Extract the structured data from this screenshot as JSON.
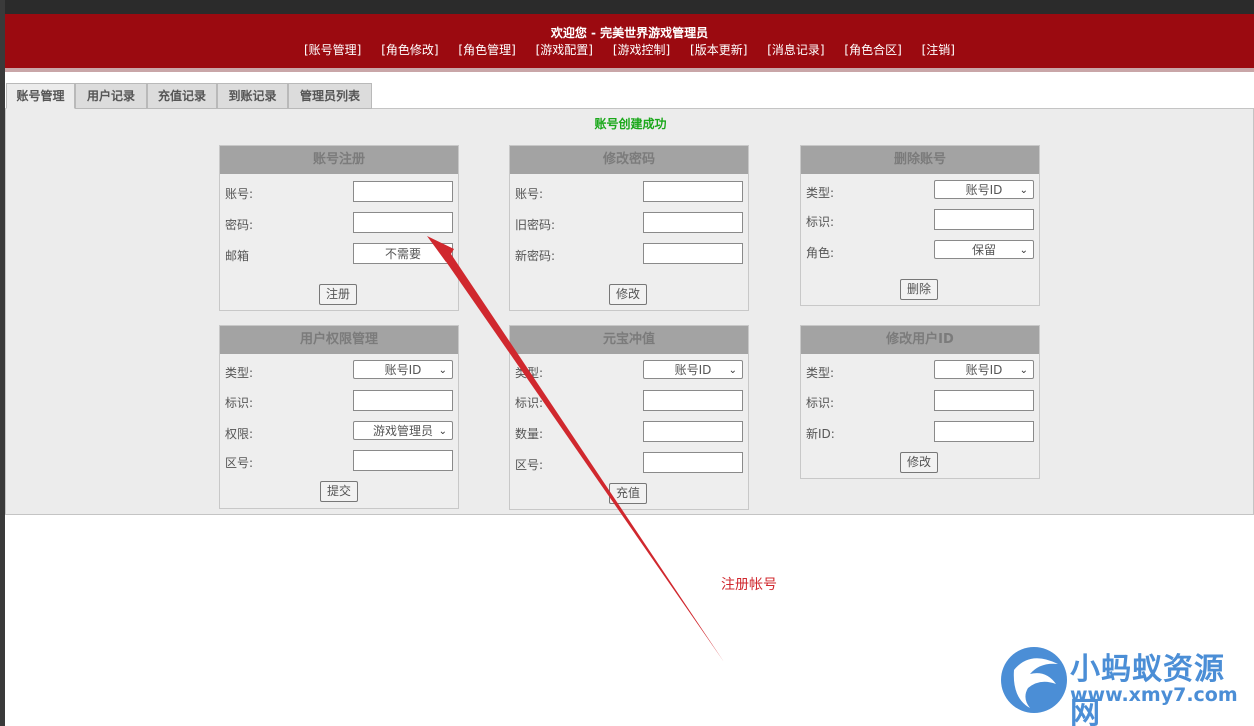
{
  "header": {
    "welcome": "欢迎您 - 完美世界游戏管理员",
    "nav": [
      "[账号管理]",
      "[角色修改]",
      "[角色管理]",
      "[游戏配置]",
      "[游戏控制]",
      "[版本更新]",
      "[消息记录]",
      "[角色合区]",
      "[注销]"
    ]
  },
  "tabs": [
    "账号管理",
    "用户记录",
    "充值记录",
    "到账记录",
    "管理员列表"
  ],
  "message": "账号创建成功",
  "register": {
    "title": "账号注册",
    "account_label": "账号:",
    "password_label": "密码:",
    "email_label": "邮箱",
    "email_value": "不需要",
    "submit": "注册"
  },
  "change_password": {
    "title": "修改密码",
    "account_label": "账号:",
    "old_label": "旧密码:",
    "new_label": "新密码:",
    "submit": "修改"
  },
  "delete_account": {
    "title": "删除账号",
    "type_label": "类型:",
    "type_value": "账号ID",
    "id_label": "标识:",
    "role_label": "角色:",
    "role_value": "保留",
    "submit": "删除"
  },
  "permissions": {
    "title": "用户权限管理",
    "type_label": "类型:",
    "type_value": "账号ID",
    "id_label": "标识:",
    "perm_label": "权限:",
    "perm_value": "游戏管理员",
    "zone_label": "区号:",
    "submit": "提交"
  },
  "recharge": {
    "title": "元宝冲值",
    "type_label": "类型:",
    "type_value": "账号ID",
    "id_label": "标识:",
    "amount_label": "数量:",
    "zone_label": "区号:",
    "submit": "充值"
  },
  "change_id": {
    "title": "修改用户ID",
    "type_label": "类型:",
    "type_value": "账号ID",
    "id_label": "标识:",
    "new_id_label": "新ID:",
    "submit": "修改"
  },
  "annotation": "注册帐号",
  "watermark": {
    "title": "小蚂蚁资源网",
    "url": "www.xmy7.com"
  },
  "colors": {
    "header": "#9b0a10",
    "success": "#1aa81a",
    "annotation": "#d0282e",
    "watermark": "#4b8ed6"
  }
}
